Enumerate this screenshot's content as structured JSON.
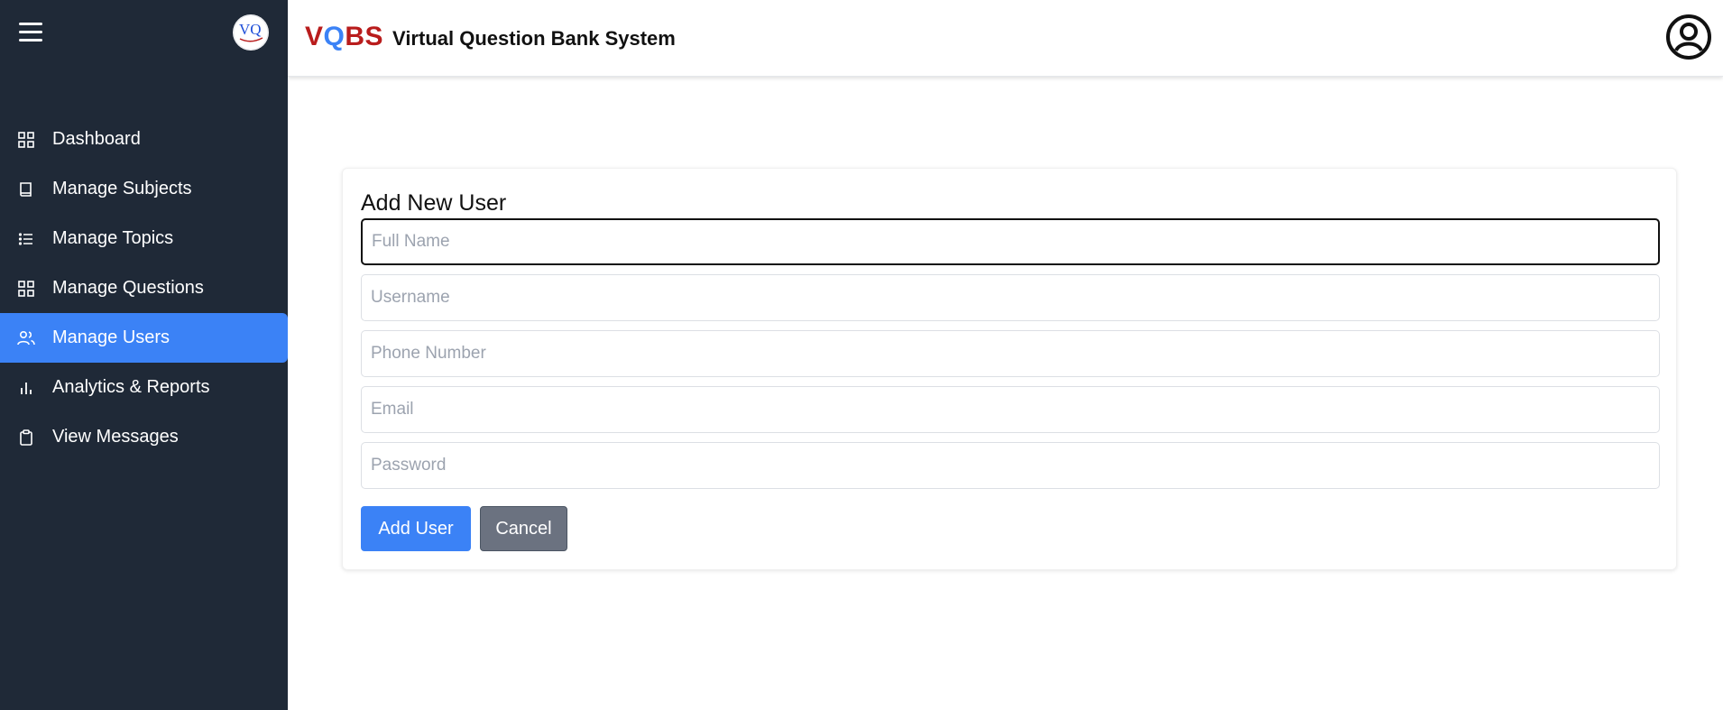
{
  "header": {
    "brand_abbr_part1": "V",
    "brand_abbr_part2": "Q",
    "brand_abbr_part3": "BS",
    "title": "Virtual Question Bank System"
  },
  "sidebar": {
    "logo_text": "VQ",
    "items": [
      {
        "label": "Dashboard",
        "icon": "grid-icon"
      },
      {
        "label": "Manage Subjects",
        "icon": "book-icon"
      },
      {
        "label": "Manage Topics",
        "icon": "list-icon"
      },
      {
        "label": "Manage Questions",
        "icon": "grid-icon"
      },
      {
        "label": "Manage Users",
        "icon": "users-icon",
        "active": true
      },
      {
        "label": "Analytics & Reports",
        "icon": "bar-chart-icon"
      },
      {
        "label": "View Messages",
        "icon": "clipboard-icon"
      }
    ]
  },
  "form": {
    "title": "Add New User",
    "fields": {
      "full_name": {
        "placeholder": "Full Name",
        "value": ""
      },
      "username": {
        "placeholder": "Username",
        "value": ""
      },
      "phone": {
        "placeholder": "Phone Number",
        "value": ""
      },
      "email": {
        "placeholder": "Email",
        "value": ""
      },
      "password": {
        "placeholder": "Password",
        "value": ""
      }
    },
    "submit_label": "Add User",
    "cancel_label": "Cancel"
  },
  "colors": {
    "sidebar_bg": "#1f2937",
    "accent": "#3b82f6",
    "brand_red": "#b91c1c",
    "cancel_bg": "#6b7280"
  }
}
